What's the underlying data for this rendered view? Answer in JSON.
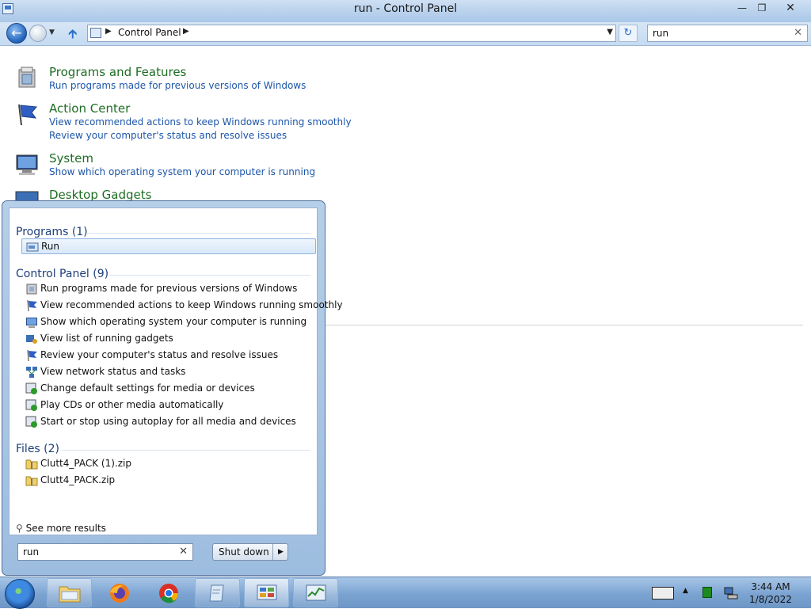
{
  "window": {
    "title": "run - Control Panel",
    "controls": {
      "minimize": "—",
      "maximize": "❐",
      "close": "✕"
    }
  },
  "address_bar": {
    "crumb": "Control Panel",
    "search_value": "run"
  },
  "results": [
    {
      "title": "Programs and Features",
      "links": [
        "Run programs made for previous versions of Windows"
      ],
      "icon": "programs-features-icon"
    },
    {
      "title": "Action Center",
      "links": [
        "View recommended actions to keep Windows running smoothly",
        "Review your computer's status and resolve issues"
      ],
      "icon": "action-center-flag-icon"
    },
    {
      "title": "System",
      "links": [
        "Show which operating system your computer is running"
      ],
      "icon": "system-monitor-icon"
    },
    {
      "title": "Desktop Gadgets",
      "links": [],
      "icon": "desktop-gadgets-icon"
    }
  ],
  "start_menu": {
    "programs_header": "Programs (1)",
    "programs": [
      {
        "label": "Run",
        "icon": "run-icon",
        "selected": true
      }
    ],
    "control_panel_header": "Control Panel (9)",
    "control_panel": [
      {
        "label": "Run programs made for previous versions of Windows",
        "icon": "programs-icon"
      },
      {
        "label": "View recommended actions to keep Windows running smoothly",
        "icon": "flag-icon"
      },
      {
        "label": "Show which operating system your computer is running",
        "icon": "system-icon"
      },
      {
        "label": "View list of running gadgets",
        "icon": "gadgets-icon"
      },
      {
        "label": "Review your computer's status and resolve issues",
        "icon": "flag-icon"
      },
      {
        "label": "View network status and tasks",
        "icon": "network-icon"
      },
      {
        "label": "Change default settings for media or devices",
        "icon": "autoplay-icon"
      },
      {
        "label": "Play CDs or other media automatically",
        "icon": "autoplay-icon"
      },
      {
        "label": "Start or stop using autoplay for all media and devices",
        "icon": "autoplay-icon"
      }
    ],
    "files_header": "Files (2)",
    "files": [
      {
        "label": "Clutt4_PACK (1).zip",
        "icon": "zip-folder-icon"
      },
      {
        "label": "Clutt4_PACK.zip",
        "icon": "zip-folder-icon"
      }
    ],
    "see_more": "See more results",
    "search_value": "run",
    "shutdown_label": "Shut down"
  },
  "taskbar": {
    "pinned": [
      "explorer-folder-icon",
      "firefox-icon",
      "chrome-icon",
      "notepad-icon",
      "control-panel-icon",
      "task-manager-icon"
    ],
    "clock_time": "3:44 AM",
    "clock_date": "1/8/2022"
  },
  "colors": {
    "link_blue": "#1d56a9",
    "title_green": "#1e6d24",
    "group_header": "#1e3f7a",
    "taskbar": "#7ba3d1"
  }
}
